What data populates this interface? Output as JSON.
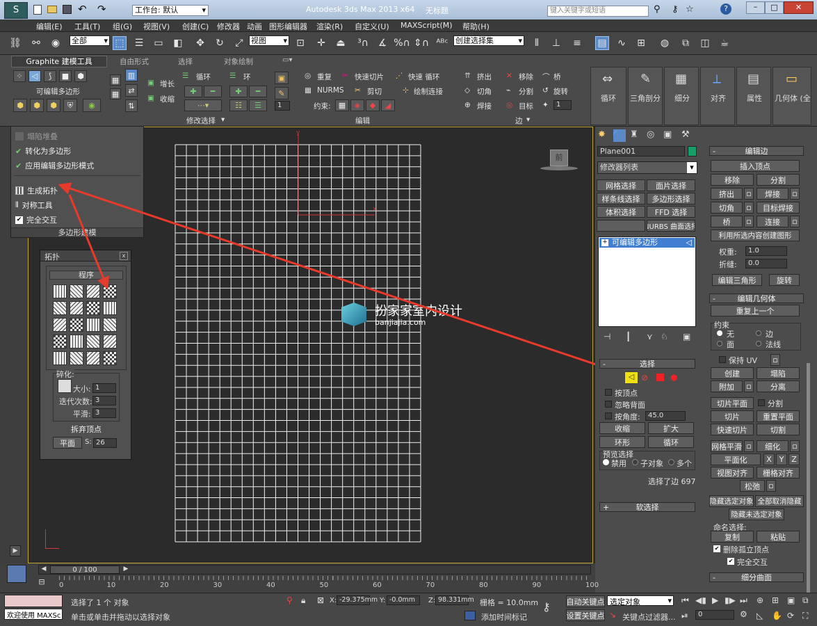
{
  "window": {
    "title": "Autodesk 3ds Max  2013 x64",
    "doc": "无标题",
    "workspace": "工作台: 默认",
    "search_placeholder": "键入关键字或短语"
  },
  "menu": [
    "编辑(E)",
    "工具(T)",
    "组(G)",
    "视图(V)",
    "创建(C)",
    "修改器",
    "动画",
    "图形编辑器",
    "渲染(R)",
    "自定义(U)",
    "MAXScript(M)",
    "帮助(H)"
  ],
  "toolbar": {
    "filter": "全部",
    "refcoord": "视图",
    "selset": "创建选择集"
  },
  "ribbon": {
    "tabs": [
      "Graphite 建模工具",
      "自由形式",
      "选择",
      "对象绘制"
    ],
    "editpoly_label": "可编辑多边形",
    "grow": "增长",
    "shrink": "收缩",
    "loop": "循环",
    "ring": "环",
    "modify_sel": "修改选择",
    "repeat": "重复",
    "quickslice": "快速切片",
    "quickloop": "快速 循环",
    "nurms": "NURMS",
    "cut": "剪切",
    "drawconn": "绘制连接",
    "constraint": "约束:",
    "edit": "编辑",
    "extrude": "挤出",
    "remove": "移除",
    "bridge": "桥",
    "chamfer": "切角",
    "split": "分割",
    "spin": "旋转",
    "weld": "焊接",
    "target": "目标",
    "edge": "边",
    "spin_val": "1",
    "big_buttons": [
      "循环",
      "三角剖分",
      "细分",
      "对齐",
      "属性",
      "几何体 (全部)"
    ]
  },
  "popup": {
    "items": [
      "塌陷堆叠",
      "转化为多边形",
      "应用编辑多边形模式",
      "生成拓扑",
      "对称工具",
      "完全交互"
    ],
    "footer": "多边形建模"
  },
  "topology": {
    "title": "拓扑",
    "program": "程序",
    "fragment": "碎化:",
    "size": "大小:",
    "size_val": "1",
    "iterations": "迭代次数:",
    "iter_val": "3",
    "smooth": "平滑:",
    "smooth_val": "3",
    "discard": "拆弃顶点",
    "plane": "平面",
    "s_label": "S:",
    "s_val": "26"
  },
  "viewport": {
    "cube_label": "前",
    "watermark_title": "扮家家室内设计",
    "watermark_url": "banjiajia.com",
    "axis_y": "y",
    "axis_x": "x"
  },
  "cmd": {
    "object_name": "Plane001",
    "modifier_list": "修改器列表",
    "mod_buttons": [
      "网格选择",
      "面片选择",
      "样条线选择",
      "多边形选择",
      "体积选择",
      "FFD 选择",
      "",
      "NURBS 曲面选择"
    ],
    "stack_item": "可编辑多边形",
    "select_head": "选择",
    "by_vertex": "按顶点",
    "ignore_back": "忽略背面",
    "by_angle": "按角度:",
    "angle_val": "45.0",
    "shrink": "收缩",
    "grow": "扩大",
    "ring": "环形",
    "loop": "循环",
    "preview": "预览选择",
    "disable": "禁用",
    "subobj": "子对象",
    "multi": "多个",
    "selected": "选择了边 697",
    "softsel": "软选择"
  },
  "right": {
    "edit_edges": "编辑边",
    "insert_vertex": "插入顶点",
    "remove": "移除",
    "split": "分割",
    "extrude": "挤出",
    "weld": "焊接",
    "chamfer": "切角",
    "target_weld": "目标焊接",
    "bridge": "桥",
    "connect": "连接",
    "create_shape": "利用所选内容创建图形",
    "weight": "权重:",
    "weight_val": "1.0",
    "crease": "折缝:",
    "crease_val": "0.0",
    "edit_tri": "编辑三角形",
    "turn": "旋转",
    "edit_geo": "编辑几何体",
    "repeat_last": "重复上一个",
    "constraint": "约束",
    "none": "无",
    "edge": "边",
    "face": "面",
    "normal": "法线",
    "preserve_uv": "保持 UV",
    "create": "创建",
    "collapse": "塌陷",
    "attach": "附加",
    "detach": "分离",
    "slice_plane": "切片平面",
    "slice": "切片",
    "reset_plane": "重置平面",
    "quickslice": "快速切片",
    "cut": "切割",
    "meshsmooth": "网格平滑",
    "tessellate": "细化",
    "planarize": "平面化",
    "x": "X",
    "y": "Y",
    "z": "Z",
    "view_align": "视图对齐",
    "grid_align": "栅格对齐",
    "relax": "松弛",
    "hide_sel": "隐藏选定对象",
    "unhide_all": "全部取消隐藏",
    "hide_unsel": "隐藏未选定对象",
    "named_sel": "命名选择:",
    "copy": "复制",
    "paste": "粘贴",
    "delete_iso": "删除孤立顶点",
    "full_interact": "完全交互",
    "subdiv_surface": "细分曲面"
  },
  "timeline": {
    "frame": "0 / 100",
    "ticks": [
      "0",
      "10",
      "20",
      "30",
      "40",
      "50",
      "60",
      "70",
      "80",
      "90",
      "100"
    ]
  },
  "status": {
    "welcome": "欢迎使用 MAXSc",
    "selected": "选择了 1 个 对象",
    "prompt": "单击或单击并拖动以选择对象",
    "x_label": "X:",
    "x_val": "-29.375mm",
    "y_label": "Y:",
    "y_val": "-0.0mm",
    "z_label": "Z:",
    "z_val": "98.331mm",
    "grid": "栅格 = 10.0mm",
    "autokey": "自动关键点",
    "selobj": "选定对象",
    "setkey": "设置关键点",
    "keyfilter": "关键点过滤器...",
    "addtime": "添加时间标记",
    "frame_val": "0"
  }
}
